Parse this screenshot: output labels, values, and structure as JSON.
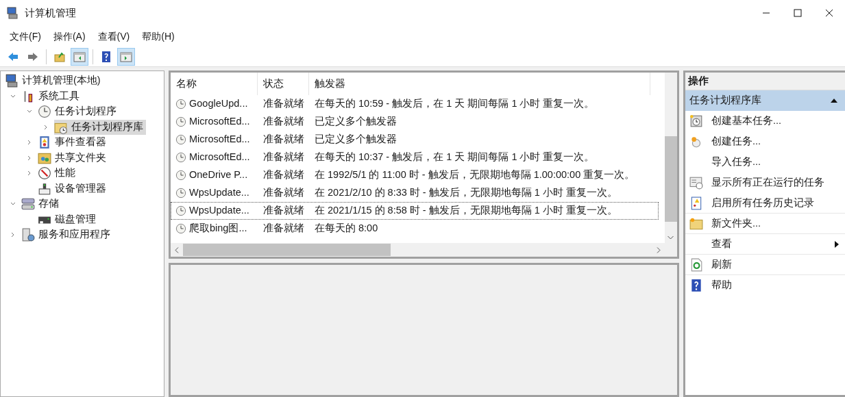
{
  "window": {
    "title": "计算机管理"
  },
  "menu": [
    "文件(F)",
    "操作(A)",
    "查看(V)",
    "帮助(H)"
  ],
  "toolbar": [
    {
      "pressed": false
    },
    {
      "pressed": false
    },
    {
      "pressed": false
    },
    {
      "pressed": true
    },
    {
      "pressed": false
    },
    {
      "pressed": true
    }
  ],
  "tree": [
    {
      "label": "计算机管理(本地)",
      "selected": false,
      "children": [
        {
          "label": "系统工具",
          "expanded": true,
          "selected": false,
          "children": [
            {
              "label": "任务计划程序",
              "expanded": true,
              "selected": false,
              "children": [
                {
                  "label": "任务计划程序库",
                  "expanded": false,
                  "selected": true
                }
              ]
            },
            {
              "label": "事件查看器",
              "expanded": false,
              "selected": false
            },
            {
              "label": "共享文件夹",
              "expanded": false,
              "selected": false
            },
            {
              "label": "性能",
              "expanded": false,
              "selected": false
            },
            {
              "label": "设备管理器",
              "selected": false
            }
          ]
        },
        {
          "label": "存储",
          "expanded": true,
          "selected": false,
          "children": [
            {
              "label": "磁盘管理",
              "selected": false
            }
          ]
        },
        {
          "label": "服务和应用程序",
          "expanded": false,
          "selected": false
        }
      ]
    }
  ],
  "table": {
    "columns": [
      "名称",
      "状态",
      "触发器"
    ],
    "rows": [
      {
        "name": "GoogleUpd...",
        "status": "准备就绪",
        "trigger": "在每天的 10:59 - 触发后，在 1 天 期间每隔 1 小时 重复一次。",
        "focused": false
      },
      {
        "name": "MicrosoftEd...",
        "status": "准备就绪",
        "trigger": "已定义多个触发器",
        "focused": false
      },
      {
        "name": "MicrosoftEd...",
        "status": "准备就绪",
        "trigger": "已定义多个触发器",
        "focused": false
      },
      {
        "name": "MicrosoftEd...",
        "status": "准备就绪",
        "trigger": "在每天的 10:37 - 触发后，在 1 天 期间每隔 1 小时 重复一次。",
        "focused": false
      },
      {
        "name": "OneDrive P...",
        "status": "准备就绪",
        "trigger": "在 1992/5/1 的 11:00 时 - 触发后，无限期地每隔 1.00:00:00 重复一次。",
        "focused": false
      },
      {
        "name": "WpsUpdate...",
        "status": "准备就绪",
        "trigger": "在 2021/2/10 的 8:33 时 - 触发后，无限期地每隔 1 小时 重复一次。",
        "focused": false
      },
      {
        "name": "WpsUpdate...",
        "status": "准备就绪",
        "trigger": "在 2021/1/15 的 8:58 时 - 触发后，无限期地每隔 1 小时 重复一次。",
        "focused": true
      },
      {
        "name": "爬取bing图...",
        "status": "准备就绪",
        "trigger": "在每天的 8:00",
        "focused": false
      }
    ]
  },
  "actions": {
    "title": "操作",
    "section": {
      "title": "任务计划程序库",
      "expanded": true
    },
    "items": [
      {
        "label": "创建基本任务...",
        "separator_after": false,
        "submenu": false
      },
      {
        "label": "创建任务...",
        "separator_after": false,
        "submenu": false
      },
      {
        "label": "导入任务...",
        "separator_after": false,
        "submenu": false
      },
      {
        "label": "显示所有正在运行的任务",
        "separator_after": false,
        "submenu": false
      },
      {
        "label": "启用所有任务历史记录",
        "separator_after": true,
        "submenu": false
      },
      {
        "label": "新文件夹...",
        "separator_after": true,
        "submenu": false
      },
      {
        "label": "查看",
        "separator_after": true,
        "submenu": true
      },
      {
        "label": "刷新",
        "separator_after": true,
        "submenu": false
      },
      {
        "label": "帮助",
        "separator_after": false,
        "submenu": false
      }
    ]
  }
}
